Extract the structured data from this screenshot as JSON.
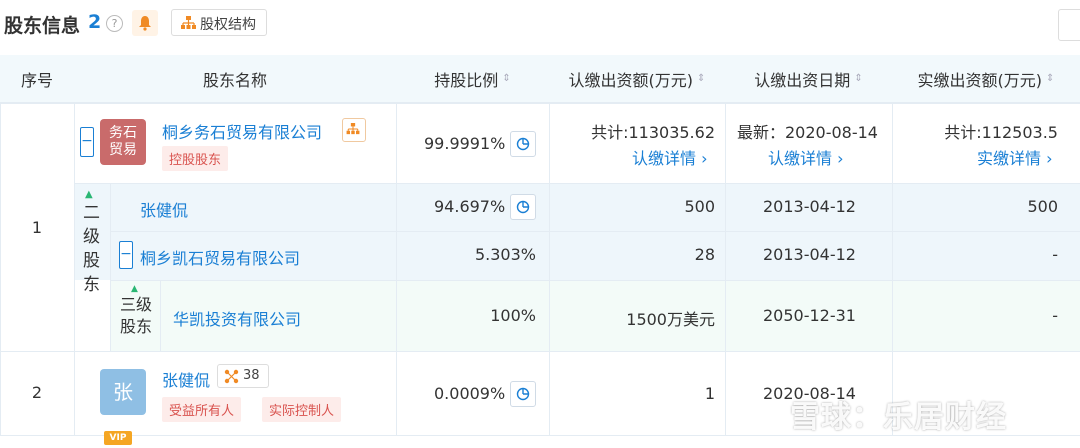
{
  "header": {
    "title": "股东信息",
    "count": "2",
    "help": "?",
    "equity_button": "股权结构"
  },
  "columns": {
    "seq": "序号",
    "name": "股东名称",
    "ratio": "持股比例",
    "subscribed_amount": "认缴出资额(万元)",
    "subscribed_date": "认缴出资日期",
    "paid_amount": "实缴出资额(万元)"
  },
  "sort_icon": "⇕",
  "row1": {
    "seq": "1",
    "avatar_text": "务石\n贸易",
    "name": "桐乡务石贸易有限公司",
    "tag": "控股股东",
    "ratio": "99.9991%",
    "subscribed_total": "共计:113035.62",
    "subscribed_link": "认缴详情",
    "latest_date": "最新：2020-08-14",
    "date_link": "认缴详情",
    "paid_total": "共计:112503.5",
    "paid_link": "实缴详情",
    "level2_label_chars": [
      "二",
      "级",
      "股",
      "东"
    ],
    "level2": [
      {
        "name": "张健侃",
        "ratio": "94.697%",
        "amount": "500",
        "date": "2013-04-12",
        "paid": "500"
      },
      {
        "name": "桐乡凯石贸易有限公司",
        "ratio": "5.303%",
        "amount": "28",
        "date": "2013-04-12",
        "paid": "-"
      }
    ],
    "level3_label": "三级\n股东",
    "level3": {
      "name": "华凯投资有限公司",
      "ratio": "100%",
      "amount": "1500万美元",
      "date": "2050-12-31",
      "paid": "-"
    }
  },
  "row2": {
    "seq": "2",
    "avatar_text": "张",
    "name": "张健侃",
    "relation_count": "38",
    "tags": [
      "受益所有人",
      "实际控制人"
    ],
    "ratio": "0.0009%",
    "amount": "1",
    "date": "2020-08-14",
    "vip": "VIP"
  },
  "watermark": "雪球：乐居财经",
  "colors": {
    "link": "#1a7fd4",
    "header_bg": "#f2f9fc",
    "level_bg": "#eef6fb",
    "level3_bg": "#f3fbf8",
    "avatar1": "#c96b6b",
    "avatar2": "#8fbfe4"
  }
}
